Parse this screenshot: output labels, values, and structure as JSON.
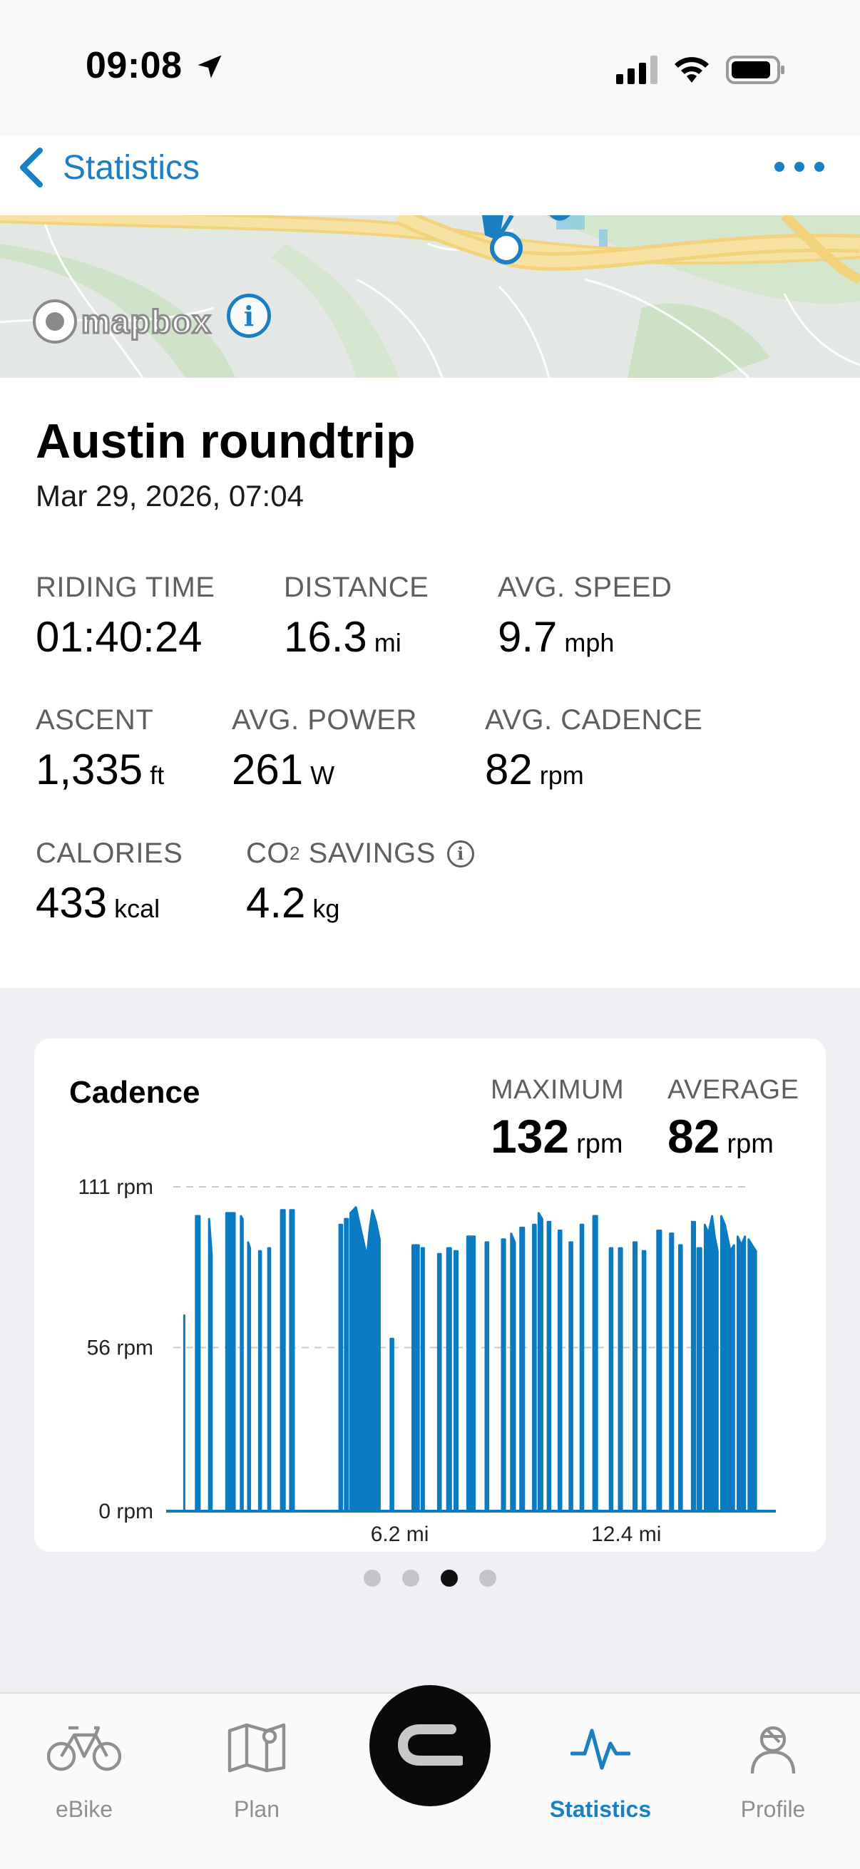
{
  "status_bar": {
    "time": "09:08"
  },
  "nav": {
    "back_label": "Statistics"
  },
  "map": {
    "attribution": "mapbox"
  },
  "ride": {
    "title": "Austin roundtrip",
    "date": "Mar 29, 2026, 07:04"
  },
  "metrics": {
    "riding_time": {
      "label": "RIDING TIME",
      "value": "01:40:24",
      "unit": ""
    },
    "distance": {
      "label": "DISTANCE",
      "value": "16.3",
      "unit": "mi"
    },
    "avg_speed": {
      "label": "AVG. SPEED",
      "value": "9.7",
      "unit": "mph"
    },
    "ascent": {
      "label": "ASCENT",
      "value": "1,335",
      "unit": "ft"
    },
    "avg_power": {
      "label": "AVG. POWER",
      "value": "261",
      "unit": "W"
    },
    "avg_cadence": {
      "label": "AVG. CADENCE",
      "value": "82",
      "unit": "rpm"
    },
    "calories": {
      "label": "CALORIES",
      "value": "433",
      "unit": "kcal"
    },
    "co2_savings": {
      "label_prefix": "CO",
      "label_sub": "2",
      "label_suffix": " SAVINGS",
      "value": "4.2",
      "unit": "kg"
    }
  },
  "chart_card": {
    "title": "Cadence",
    "maximum_label": "MAXIMUM",
    "maximum_value": "132",
    "maximum_unit": "rpm",
    "average_label": "AVERAGE",
    "average_value": "82",
    "average_unit": "rpm"
  },
  "chart_data": {
    "type": "area",
    "title": "Cadence",
    "xlabel": "",
    "ylabel": "",
    "ylim": [
      0,
      111
    ],
    "xlim": [
      0,
      16.3
    ],
    "y_ticks": [
      "0 rpm",
      "56 rpm",
      "111 rpm"
    ],
    "y_tick_values": [
      0,
      56,
      111
    ],
    "x_ticks": [
      "6.2 mi",
      "12.4 mi"
    ],
    "x_tick_values": [
      6.2,
      12.4
    ],
    "grid": true,
    "series": [
      {
        "color": "#0a7bc2",
        "segments": [
          [
            [
              0.3,
              67
            ],
            [
              0.3,
              0
            ]
          ],
          [
            [
              0.62,
              101
            ],
            [
              0.72,
              101
            ]
          ],
          [
            [
              0.98,
              100
            ],
            [
              1.05,
              88
            ]
          ],
          [
            [
              1.45,
              102
            ],
            [
              1.68,
              102
            ]
          ],
          [
            [
              1.85,
              101
            ],
            [
              1.9,
              100
            ]
          ],
          [
            [
              2.05,
              92
            ],
            [
              2.1,
              90
            ]
          ],
          [
            [
              2.35,
              89
            ],
            [
              2.4,
              89
            ]
          ],
          [
            [
              2.6,
              90
            ],
            [
              2.65,
              90
            ]
          ],
          [
            [
              2.95,
              103
            ],
            [
              3.05,
              103
            ]
          ],
          [
            [
              3.2,
              103
            ],
            [
              3.3,
              103
            ]
          ],
          [
            [
              4.55,
              98
            ],
            [
              4.62,
              98
            ]
          ],
          [
            [
              4.7,
              100
            ],
            [
              4.78,
              100
            ]
          ],
          [
            [
              4.85,
              102
            ],
            [
              5.0,
              104
            ],
            [
              5.3,
              87
            ],
            [
              5.38,
              97
            ],
            [
              5.45,
              103
            ],
            [
              5.55,
              99
            ],
            [
              5.65,
              93
            ]
          ],
          [
            [
              5.95,
              59
            ],
            [
              6.02,
              59
            ]
          ],
          [
            [
              6.55,
              91
            ],
            [
              6.72,
              91
            ]
          ],
          [
            [
              6.8,
              90
            ],
            [
              6.86,
              90
            ]
          ],
          [
            [
              7.25,
              88
            ],
            [
              7.32,
              88
            ]
          ],
          [
            [
              7.5,
              90
            ],
            [
              7.6,
              90
            ]
          ],
          [
            [
              7.7,
              89
            ],
            [
              7.78,
              89
            ]
          ],
          [
            [
              8.05,
              94
            ],
            [
              8.25,
              94
            ]
          ],
          [
            [
              8.55,
              92
            ],
            [
              8.62,
              92
            ]
          ],
          [
            [
              9.0,
              93
            ],
            [
              9.08,
              93
            ]
          ],
          [
            [
              9.25,
              95
            ],
            [
              9.35,
              92
            ]
          ],
          [
            [
              9.5,
              97
            ],
            [
              9.6,
              97
            ]
          ],
          [
            [
              9.85,
              98
            ],
            [
              9.92,
              98
            ]
          ],
          [
            [
              10.0,
              102
            ],
            [
              10.1,
              100
            ]
          ],
          [
            [
              10.25,
              99
            ],
            [
              10.32,
              99
            ]
          ],
          [
            [
              10.55,
              96
            ],
            [
              10.62,
              96
            ]
          ],
          [
            [
              10.85,
              92
            ],
            [
              10.92,
              92
            ]
          ],
          [
            [
              11.15,
              98
            ],
            [
              11.22,
              98
            ]
          ],
          [
            [
              11.5,
              101
            ],
            [
              11.6,
              101
            ]
          ],
          [
            [
              11.95,
              90
            ],
            [
              12.02,
              90
            ]
          ],
          [
            [
              12.2,
              90
            ],
            [
              12.28,
              90
            ]
          ],
          [
            [
              12.6,
              92
            ],
            [
              12.68,
              92
            ]
          ],
          [
            [
              12.85,
              89
            ],
            [
              12.92,
              89
            ]
          ],
          [
            [
              13.25,
              96
            ],
            [
              13.35,
              96
            ]
          ],
          [
            [
              13.6,
              95
            ],
            [
              13.68,
              95
            ]
          ],
          [
            [
              13.85,
              91
            ],
            [
              13.92,
              91
            ]
          ],
          [
            [
              14.2,
              99
            ],
            [
              14.28,
              99
            ]
          ],
          [
            [
              14.35,
              90
            ],
            [
              14.45,
              90
            ]
          ],
          [
            [
              14.55,
              98
            ],
            [
              14.65,
              95
            ],
            [
              14.75,
              101
            ],
            [
              14.82,
              94
            ],
            [
              14.9,
              89
            ]
          ],
          [
            [
              15.0,
              101
            ],
            [
              15.1,
              98
            ],
            [
              15.25,
              89
            ],
            [
              15.35,
              91
            ]
          ],
          [
            [
              15.45,
              94
            ],
            [
              15.55,
              91
            ],
            [
              15.65,
              94
            ]
          ],
          [
            [
              15.75,
              93
            ],
            [
              15.85,
              91
            ],
            [
              15.95,
              89
            ]
          ]
        ]
      }
    ]
  },
  "pager": {
    "count": 4,
    "active_index": 2
  },
  "tab_bar": {
    "tabs": [
      {
        "label": "eBike",
        "icon": "bike-icon",
        "active": false
      },
      {
        "label": "Plan",
        "icon": "map-pin-icon",
        "active": false
      },
      {
        "label": "Statistics",
        "icon": "pulse-icon",
        "active": true
      },
      {
        "label": "Profile",
        "icon": "helmet-user-icon",
        "active": false
      }
    ],
    "center_button_icon": "ride-start-icon"
  }
}
